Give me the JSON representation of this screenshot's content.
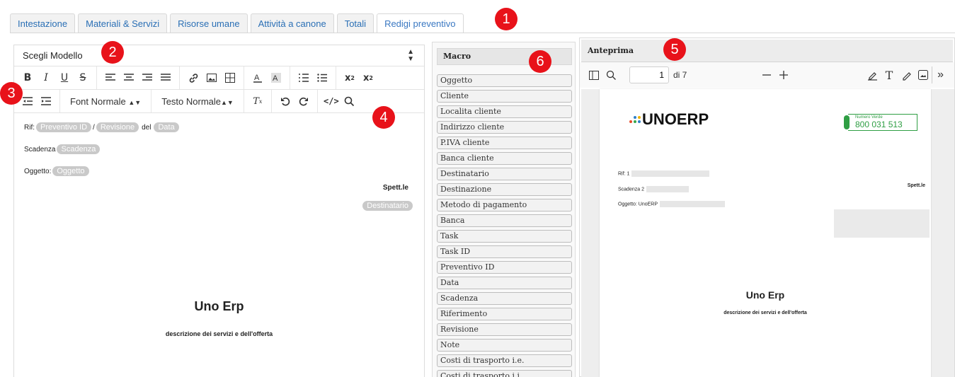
{
  "tabs": [
    {
      "label": "Intestazione"
    },
    {
      "label": "Materiali & Servizi"
    },
    {
      "label": "Risorse umane"
    },
    {
      "label": "Attività a canone"
    },
    {
      "label": "Totali"
    },
    {
      "label": "Redigi preventivo"
    }
  ],
  "editor": {
    "model_select": "Scegli Modello",
    "font_dropdown": "Font Normale",
    "text_dropdown": "Testo Normale",
    "content": {
      "rif_label": "Rif:",
      "chip_preventivo_id": "Preventivo ID",
      "slash": "/",
      "chip_revisione": "Revisione",
      "del_label": "del",
      "chip_data": "Data",
      "scadenza_label": "Scadenza",
      "chip_scadenza": "Scadenza",
      "oggetto_label": "Oggetto:",
      "chip_oggetto": "Oggetto",
      "spett": "Spett.le",
      "chip_destinatario": "Destinatario",
      "title": "Uno Erp",
      "subtitle": "descrizione dei servizi e dell'offerta"
    }
  },
  "macro": {
    "header": "Macro",
    "items": [
      "Oggetto",
      "Cliente",
      "Localita cliente",
      "Indirizzo cliente",
      "P.IVA cliente",
      "Banca cliente",
      "Destinatario",
      "Destinazione",
      "Metodo di pagamento",
      "Banca",
      "Task",
      "Task ID",
      "Preventivo ID",
      "Data",
      "Scadenza",
      "Riferimento",
      "Revisione",
      "Note",
      "Costi di trasporto i.e.",
      "Costi di trasporto i.i."
    ]
  },
  "preview": {
    "header": "Anteprima",
    "page_value": "1",
    "of_pages": "di 7",
    "logo_text": "UNOERP",
    "green_small": "Numero Verde",
    "green_number": "800 031 513",
    "rif": "Rif: 1",
    "scadenza": "Scadenza 2",
    "oggetto": "Oggetto: UnoERP",
    "spett": "Spett.le",
    "title": "Uno Erp",
    "subtitle": "descrizione dei servizi e dell'offerta"
  },
  "callouts": [
    "1",
    "2",
    "3",
    "4",
    "5",
    "6"
  ],
  "colors": {
    "tab_text": "#2a6fb5",
    "callout": "#e8121a",
    "chip": "#c9c9c9",
    "green": "#2f9e44"
  }
}
